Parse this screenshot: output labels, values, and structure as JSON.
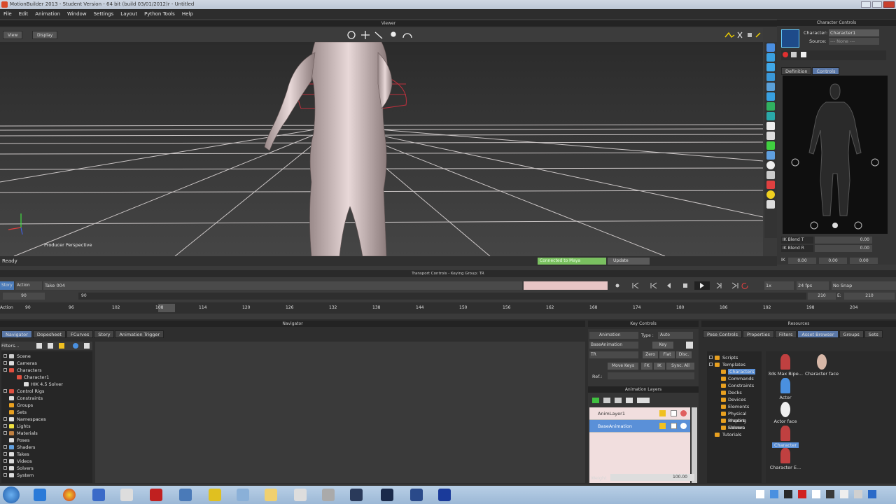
{
  "window": {
    "title": "MotionBuilder 2013 - Student Version - 64 bit (build 03/01/2012)r - Untitled"
  },
  "menu": [
    "File",
    "Edit",
    "Animation",
    "Window",
    "Settings",
    "Layout",
    "Python Tools",
    "Help"
  ],
  "viewer": {
    "title": "Viewer",
    "view_label": "View",
    "display_label": "Display",
    "camera_label": "Producer Perspective"
  },
  "status": {
    "text": "Ready",
    "connection": "Connected to Maya",
    "update_label": "Update"
  },
  "character_controls": {
    "title": "Character Controls",
    "character_label": "Character:",
    "character_value": "Character1",
    "source_label": "Source:",
    "source_value": "--- None ---",
    "tab_definition": "Definition",
    "tab_controls": "Controls",
    "ik_blend_t": "IK Blend T",
    "ik_blend_r": "IK Blend R",
    "ik_t_value": "0.00",
    "ik_r_value": "0.00",
    "ik_label": "IK",
    "coord_values": [
      "0.00",
      "0.00",
      "0.00"
    ]
  },
  "transport": {
    "title": "Transport Controls - Keying Group: TR",
    "story_label": "Story",
    "action_label": "Action",
    "take": "Take 004",
    "speed": "1x",
    "fps": "24 fps",
    "snap": "No Snap",
    "start_frame": "90",
    "current_frame": "90",
    "end_frame": "210",
    "end_frame2": "210",
    "end_label": "E:",
    "action_row_label": "Action"
  },
  "ruler_ticks": [
    "90",
    "96",
    "102",
    "108",
    "114",
    "120",
    "126",
    "132",
    "138",
    "144",
    "150",
    "156",
    "162",
    "168",
    "174",
    "180",
    "186",
    "192",
    "198",
    "204"
  ],
  "navigator": {
    "title": "Navigator",
    "tabs": [
      "Navigator",
      "Dopesheet",
      "FCurves",
      "Story",
      "Animation Trigger"
    ],
    "filter_label": "Filters...",
    "tree": [
      "Scene",
      "Cameras",
      "Characters",
      "Character1",
      "HIK 4.5 Solver",
      "Control Rigs",
      "Constraints",
      "Groups",
      "Sets",
      "Namespaces",
      "Lights",
      "Materials",
      "Poses",
      "Shaders",
      "Takes",
      "Videos",
      "Solvers",
      "System"
    ]
  },
  "key_controls": {
    "title": "Key Controls",
    "animation_label": "Animation",
    "type_label": "Type :",
    "type_value": "Auto",
    "base_animation": "BaseAnimation",
    "key_label": "Key",
    "tr_value": "TR",
    "zero": "Zero",
    "flat": "Flat",
    "disc": "Disc.",
    "move_keys": "Move Keys",
    "fk": "FK",
    "ik": "IK",
    "sync_all": "Sync. All",
    "ref_label": "Ref.:",
    "layers_title": "Animation Layers",
    "layers": [
      "AnimLayer1",
      "BaseAnimation"
    ],
    "weight_label": "Weight",
    "weight_value": "100.00"
  },
  "resources": {
    "title": "Resources",
    "tabs": [
      "Pose Controls",
      "Properties",
      "Filters",
      "Asset Browser",
      "Groups",
      "Sets"
    ],
    "tree": [
      "Scripts",
      "Templates",
      "Characters",
      "Commands",
      "Constraints",
      "Decks",
      "Devices",
      "Elements",
      "Physical Propert",
      "Shading Elemen",
      "Solvers",
      "Tutorials"
    ],
    "assets": [
      "3ds Max Bipe...",
      "Character face",
      "Actor",
      "Actor face",
      "Character",
      "Character E..."
    ]
  }
}
